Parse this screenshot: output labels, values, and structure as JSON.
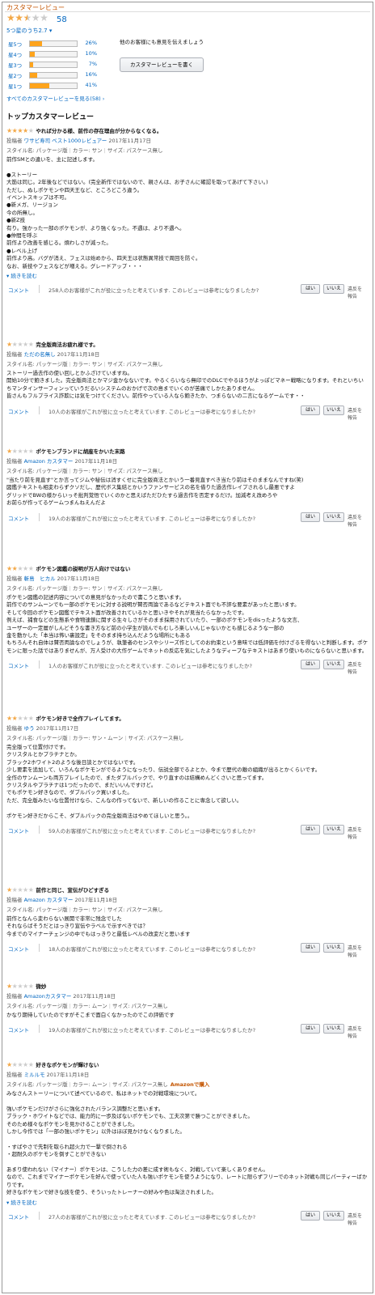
{
  "header": {
    "title": "カスタマーレビュー",
    "total_reviews": "58",
    "average": "5つ星のうち2.7",
    "rating_fraction": 0.54
  },
  "histogram": [
    {
      "label": "星5つ",
      "pct": "26%",
      "value": 26
    },
    {
      "label": "星4つ",
      "pct": "10%",
      "value": 10
    },
    {
      "label": "星3つ",
      "pct": "7%",
      "value": 7
    },
    {
      "label": "星2つ",
      "pct": "16%",
      "value": 16
    },
    {
      "label": "星1つ",
      "pct": "41%",
      "value": 41
    }
  ],
  "share_text": "他のお客様にも意見を伝えましょう",
  "write_button": "カスタマーレビューを書く",
  "see_all": "すべてのカスタマーレビューを見る(58) ›",
  "top_title": "トップカスタマーレビュー",
  "labels": {
    "comment": "コメント",
    "yes": "はい",
    "no": "いいえ",
    "report": "違反を報告",
    "read_more": "続きを読む",
    "posted_by": "投稿者",
    "style": "スタイル名: パッケージ版",
    "sep": "|",
    "helpful_suffix": "人のお客様がこれが役に立ったと考えています. このレビューは参考になりましたか?"
  },
  "reviews": [
    {
      "stars": 4,
      "title": "やれば分かる様、前作の存在理由が分からなくなる。",
      "author": "ワサビ寿司",
      "badge": "ベスト1000レビュアー",
      "date": "2017年11月17日",
      "color": "カラー: サン",
      "size": "サイズ: パスケース無し",
      "verified": "",
      "body": "前作SMとの違いを、主に記述します。\n\n●ストーリー\n大筋は同じ。2年後などではない。(完全新作ではないので、親さんは、お子さんに確認を取ってあげて下さい。)\nただし、ぬしポケモンや四天王など、ところどころ違う。\nイベントスキップは不可。\n●新メガ、リージョン\n今の所無し。\n●新Z技\n有り。強かった一部のポケモンが、より強くなった。不遇は、より不遇へ。\n●仲間を呼ぶ\n前作より改善を感じる。煩わしさが減った。\n●レベル上げ\n前作より高。バグが消え、フェスは始めから、四天王は状態異常技で周回を防ぐ。\nなお、新技やフェスなどが増える。グレードアップ・・・",
      "more": true,
      "helpful": "258"
    },
    {
      "stars": 1,
      "title": "完全版商法お疲れ様です。",
      "author": "ただの名無し",
      "badge": "",
      "date": "2017年11月18日",
      "color": "カラー: サン",
      "size": "サイズ: パスケース無し",
      "verified": "",
      "body": "ストーリー過去作の使い回しとかふざけていますね。\n開始10分で飽きました。完全版商法とかマジ金かなないです。やるくらいなら無印でのDLCでやるほうがよっぽどマネー戦略になります。それといちいちマンタインサーフィンっていうだるいシステムのおかげで次の島までいくのが苦痛でしかたありません。\n皆さんもフルプライス詐欺には気をつけてください。前作やっている人なら飽きたか、つまらないの二言になるゲームです・・",
      "more": false,
      "helpful": "10"
    },
    {
      "stars": 1,
      "title": "ポケモンブランドに胡座をかいた末路",
      "author": "Amazon カスタマー",
      "badge": "",
      "date": "2017年11月18日",
      "color": "カラー: サン",
      "size": "サイズ: パスケース無し",
      "verified": "",
      "body": "\"当たり前を見直す\"とか言ってジムや秘伝は消すくせに完全版商法とかいう一番見直すべき当たり前はそのままなんですね(笑)\n図鑑テキストも相変わらずクソだし、歴代ボス集結とかいうファンサービスの名を借りた過去作レイプされるし最悪ですよ\nグリッドでBWの様からいっそ批判覚悟でいくのかと思えばただひたすら過去作を否定するだけ。加減考え改めろや\nお前らが作ってるゲームつまんねえんだよ",
      "more": false,
      "helpful": "19"
    },
    {
      "stars": 2,
      "title": "ポケモン図鑑の説明が万人向けではない",
      "author": "斬島　ヒカル",
      "badge": "",
      "date": "2017年11月18日",
      "color": "カラー: サン",
      "size": "サイズ: パスケース無し",
      "verified": "",
      "body": "ポケモン図鑑の記述内容についての意見がなかったので書こうと思います。\n前作でのサンムーンでも一部のポケモンに対する説明が賛否両論であるなどテキスト面でも不評な要素があったと思います。\nそして今回のポケモン図鑑でテキスト面が改善されているかと思いきやそれが見当たらなかったです。\n例えば、捕食などの生態系や食物連鎖に関する生々しさがそのまま採用されていたり、一部のポケモンをdisったような文言、\nユーザーの一定層がしんどそうな書き方など前の小学生が読んでもむしろ楽しいんじゃないかとも感じるような一部の\n金を動かした「本当は怖い裏設定」をそのまま持ち込んだような場所にもある\nもちろんそれ自体は賛否両論なのでしょうが、執筆者のセンスやシリーズ作としてのお約束という意味では低評価を付けざるを得ないと判断します。ポケモンに限った話ではありませんが、万人受けの大作ゲームでネットの反応を気にしたようなディープなテキストはあまり使いものにならないと思います。",
      "more": false,
      "helpful": "1"
    },
    {
      "stars": 2,
      "title": "ポケモン好きで全作プレイしてます。",
      "author": "ゆう",
      "badge": "",
      "date": "2017年11月17日",
      "color": "カラー: サン・ムーン",
      "size": "サイズ: パスケース無し",
      "verified": "",
      "body": "完全版って位置付けです。\nクリスタルとかプラチナとか。\nブラック2ホワイト2のような後日談とかではないです。\n少し要素を追加して、いろんなポケモンがでるようになったり、伝説全部でるよとか、今まで歴代の敵の組織が出るとかくらいです。\n全作のサンムーンも両方プレイしたので、またダブルパックで、やり直すのは結構めんどくさいと思ってます。\nクリスタルやプラチナは1つだったので、まだいいんですけど。\nでもポケモン好きなので、ダブルパック買いました。\nただ、完全版みたいな位置付けなら、こんなの作ってないで、新しいの作ることに専念して欲しい。\n\nポケモン好きだからこそ、ダブルパックの完全版商法はやめてほしいと思う。。",
      "more": false,
      "helpful": "59"
    },
    {
      "stars": 1,
      "title": "前作と同じ、宣伝がひどすぎる",
      "author": "Amazon カスタマー",
      "badge": "",
      "date": "2017年11月18日",
      "color": "カラー: サン",
      "size": "サイズ: パスケース無し",
      "verified": "",
      "body": "前作となんら変わらない展開で非常に残念でした\nそれならばそうだとはっきり宣伝やラベルで示すべきでは？\n今までのマイナーチェンジの中でもはっきりと最低レベルの改変だと思います",
      "more": false,
      "helpful": "18"
    },
    {
      "stars": 1,
      "title": "微妙",
      "author": "Amazonカスタマー",
      "badge": "",
      "date": "2017年11月18日",
      "color": "カラー: ムーン",
      "size": "サイズ: パスケース無し",
      "verified": "",
      "body": "かなり期待していたのですがそこまで面白くなかったのでこの評価です",
      "more": false,
      "helpful": "19"
    },
    {
      "stars": 1,
      "title": "好きなポケモンが輝けない",
      "author": "ミルルモ",
      "badge": "",
      "date": "2017年11月18日",
      "color": "カラー: ムーン",
      "size": "サイズ: パスケース無し",
      "verified": "Amazonで購入",
      "body": "みなさんストーリーについて述べているので、私はネットでの対戦環境について。\n\n強いポケモンだけがさらに強化されたバランス調整だと思います。\nブラック・ホワイトなどでは、能力的に一歩及ばないポケモンでも、工夫次第で勝つことができました。\nそのため様々なポケモンを見かけることができました。\nしかし今作では「一部の強いポケモン」以外はほぼ見かけなくなりました。\n\n・すばやさで先制を取られ超火力で一撃で倒される\n・超耐久のポケモンを倒すことができない\n\nあまり使われない（マイナー）ポケモンは、こうした力の差に成す術もなく、対戦していて楽しくありません。\nなので、これまでマイナーポケモンを好んで使っていた人も強いポケモンを使うようになり、レートに限らずフリーでのネット対戦も同じパーティーばかりです。\n好きなポケモンで好きな技を使う、そういったトレーナーの好みや色は淘汰されました。",
      "more": true,
      "helpful": "27"
    }
  ]
}
